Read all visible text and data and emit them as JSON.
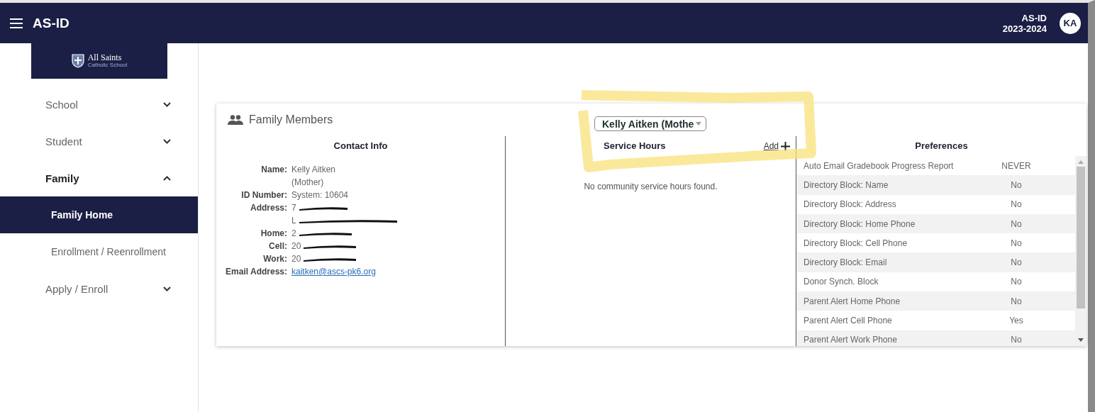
{
  "header": {
    "app_name": "AS-ID",
    "org": "AS-ID",
    "year": "2023-2024",
    "avatar": "KA"
  },
  "sidebar": {
    "logo": {
      "name": "All Saints",
      "subtitle": "Catholic School"
    },
    "items": [
      {
        "label": "School",
        "kind": "group",
        "expanded": false,
        "selected": false
      },
      {
        "label": "Student",
        "kind": "group",
        "expanded": false,
        "selected": false
      },
      {
        "label": "Family",
        "kind": "group",
        "expanded": true,
        "selected": false
      },
      {
        "label": "Family Home",
        "kind": "sub",
        "selected": true
      },
      {
        "label": "Enrollment / Reenrollment",
        "kind": "sub",
        "selected": false
      },
      {
        "label": "Apply / Enroll",
        "kind": "group",
        "expanded": false,
        "selected": false
      }
    ]
  },
  "card": {
    "title": "Family Members",
    "member_select": "Kelly Aitken (Mothe",
    "highlighter_mark": true,
    "contact": {
      "heading": "Contact Info",
      "rows": [
        {
          "label": "Name:",
          "lines": [
            "Kelly Aitken",
            "(Mother)"
          ],
          "kind": "text"
        },
        {
          "label": "ID Number:",
          "lines": [
            "System: 10604"
          ],
          "kind": "text"
        },
        {
          "label": "Address:",
          "lines": [
            "7",
            "L"
          ],
          "kind": "redacted"
        },
        {
          "label": "Home:",
          "lines": [
            "2"
          ],
          "kind": "redacted"
        },
        {
          "label": "Cell:",
          "lines": [
            "20"
          ],
          "kind": "redacted"
        },
        {
          "label": "Work:",
          "lines": [
            "20"
          ],
          "kind": "redacted"
        },
        {
          "label": "Email Address:",
          "lines": [
            "kaitken@ascs-pk6.org"
          ],
          "kind": "link"
        }
      ]
    },
    "service": {
      "heading": "Service Hours",
      "add": "Add",
      "empty": "No community service hours found."
    },
    "preferences": {
      "heading": "Preferences",
      "rows": [
        {
          "name": "Auto Email Gradebook Progress Report",
          "value": "NEVER"
        },
        {
          "name": "Directory Block: Name",
          "value": "No"
        },
        {
          "name": "Directory Block: Address",
          "value": "No"
        },
        {
          "name": "Directory Block: Home Phone",
          "value": "No"
        },
        {
          "name": "Directory Block: Cell Phone",
          "value": "No"
        },
        {
          "name": "Directory Block: Email",
          "value": "No"
        },
        {
          "name": "Donor Synch. Block",
          "value": "No"
        },
        {
          "name": "Parent Alert Home Phone",
          "value": "No"
        },
        {
          "name": "Parent Alert Cell Phone",
          "value": "Yes"
        },
        {
          "name": "Parent Alert Work Phone",
          "value": "No"
        }
      ]
    }
  }
}
